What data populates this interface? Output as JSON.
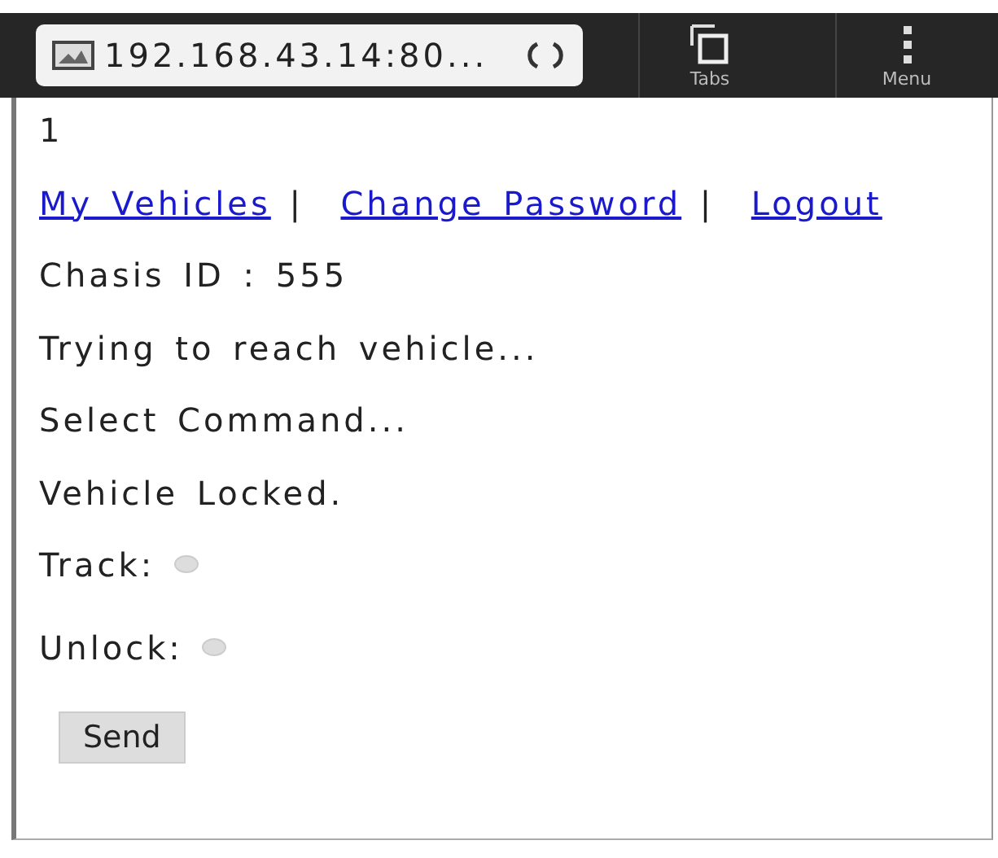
{
  "browser_bar": {
    "url": "192.168.43.14:80...",
    "tabs_label": "Tabs",
    "menu_label": "Menu"
  },
  "page": {
    "counter": "1",
    "links": [
      {
        "label": "My Vehicles"
      },
      {
        "label": "Change Password"
      },
      {
        "label": "Logout"
      }
    ],
    "separator": "|",
    "messages": [
      "Chasis ID : 555",
      "Trying to reach vehicle...",
      "Select Command...",
      "Vehicle Locked."
    ],
    "options": [
      {
        "label": "Track:",
        "selected": false
      },
      {
        "label": "Unlock:",
        "selected": false
      }
    ],
    "button": "Send"
  }
}
